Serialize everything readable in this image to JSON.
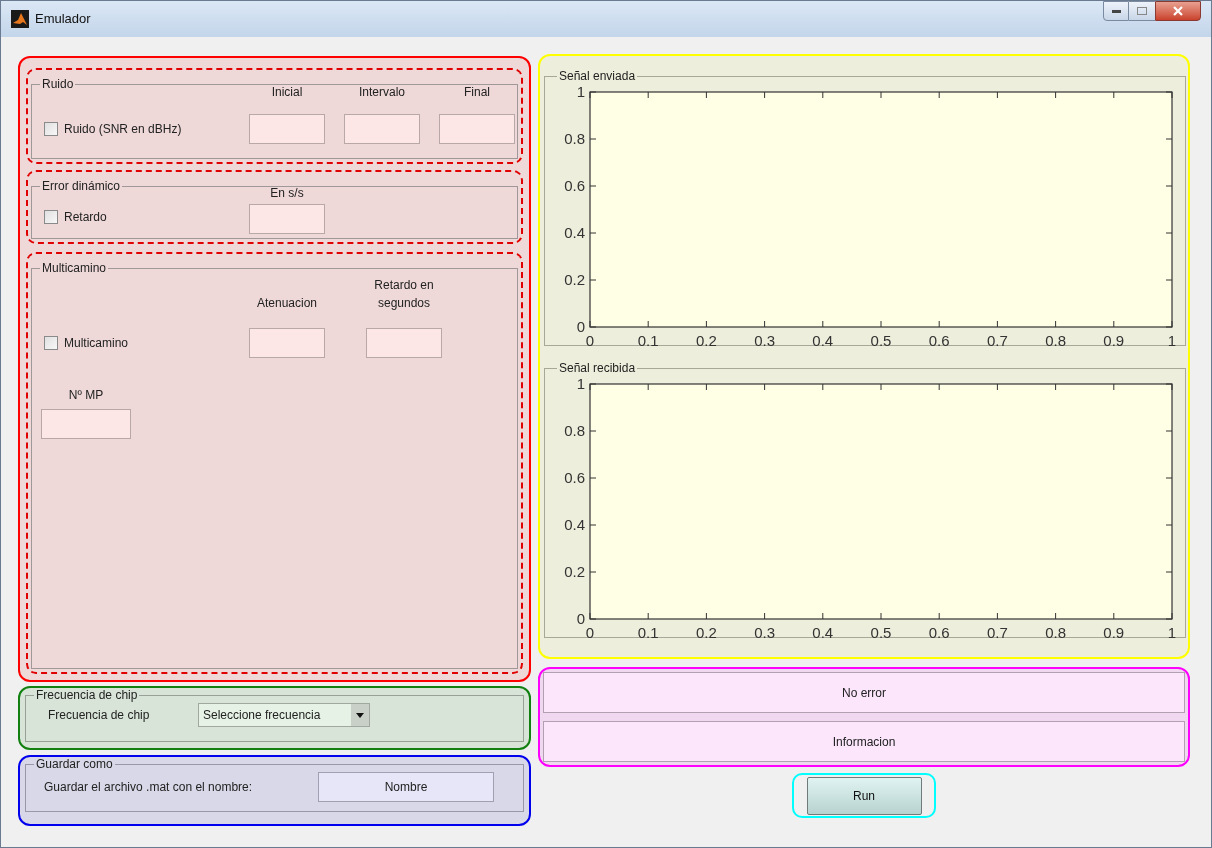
{
  "window": {
    "title": "Emulador"
  },
  "ruido": {
    "title": "Ruido",
    "columns": [
      "Inicial",
      "Intervalo",
      "Final"
    ],
    "checkbox": {
      "label": "Ruido (SNR en dBHz)",
      "checked": false
    }
  },
  "error_dinamico": {
    "title": "Error dinámico",
    "columns": [
      "En s/s"
    ],
    "checkbox": {
      "label": "Retardo",
      "checked": false
    }
  },
  "multicamino": {
    "title": "Multicamino",
    "columns": [
      "Atenuacion",
      "Retardo en segundos"
    ],
    "checkbox": {
      "label": "Multicamino",
      "checked": false
    },
    "mp_label": "Nº MP"
  },
  "frecuencia": {
    "title": "Frecuencia de chip",
    "label": "Frecuencia de chip",
    "dropdown": "Seleccione frecuencia"
  },
  "guardar": {
    "title": "Guardar como",
    "label": "Guardar el archivo .mat con el nombre:",
    "field": "Nombre"
  },
  "plots": [
    {
      "title": "Señal enviada",
      "chart_data": {
        "type": "line",
        "xlim": [
          0,
          1
        ],
        "ylim": [
          0,
          1
        ],
        "xticks": [
          {
            "value": 0,
            "label": "0"
          },
          {
            "value": 0.1,
            "label": "0.1"
          },
          {
            "value": 0.2,
            "label": "0.2"
          },
          {
            "value": 0.3,
            "label": "0.3"
          },
          {
            "value": 0.4,
            "label": "0.4"
          },
          {
            "value": 0.5,
            "label": "0.5"
          },
          {
            "value": 0.6,
            "label": "0.6"
          },
          {
            "value": 0.7,
            "label": "0.7"
          },
          {
            "value": 0.8,
            "label": "0.8"
          },
          {
            "value": 0.9,
            "label": "0.9"
          },
          {
            "value": 1,
            "label": "1"
          }
        ],
        "yticks": [
          {
            "value": 0,
            "label": "0"
          },
          {
            "value": 0.2,
            "label": "0.2"
          },
          {
            "value": 0.4,
            "label": "0.4"
          },
          {
            "value": 0.6,
            "label": "0.6"
          },
          {
            "value": 0.8,
            "label": "0.8"
          },
          {
            "value": 1,
            "label": "1"
          }
        ]
      }
    },
    {
      "title": "Señal recibida",
      "chart_data": {
        "type": "line",
        "xlim": [
          0,
          1
        ],
        "ylim": [
          0,
          1
        ],
        "xticks": [
          {
            "value": 0,
            "label": "0"
          },
          {
            "value": 0.1,
            "label": "0.1"
          },
          {
            "value": 0.2,
            "label": "0.2"
          },
          {
            "value": 0.3,
            "label": "0.3"
          },
          {
            "value": 0.4,
            "label": "0.4"
          },
          {
            "value": 0.5,
            "label": "0.5"
          },
          {
            "value": 0.6,
            "label": "0.6"
          },
          {
            "value": 0.7,
            "label": "0.7"
          },
          {
            "value": 0.8,
            "label": "0.8"
          },
          {
            "value": 0.9,
            "label": "0.9"
          },
          {
            "value": 1,
            "label": "1"
          }
        ],
        "yticks": [
          {
            "value": 0,
            "label": "0"
          },
          {
            "value": 0.2,
            "label": "0.2"
          },
          {
            "value": 0.4,
            "label": "0.4"
          },
          {
            "value": 0.6,
            "label": "0.6"
          },
          {
            "value": 0.8,
            "label": "0.8"
          },
          {
            "value": 1,
            "label": "1"
          }
        ]
      }
    }
  ],
  "status": [
    "No error",
    "Informacion"
  ],
  "run_button": "Run"
}
